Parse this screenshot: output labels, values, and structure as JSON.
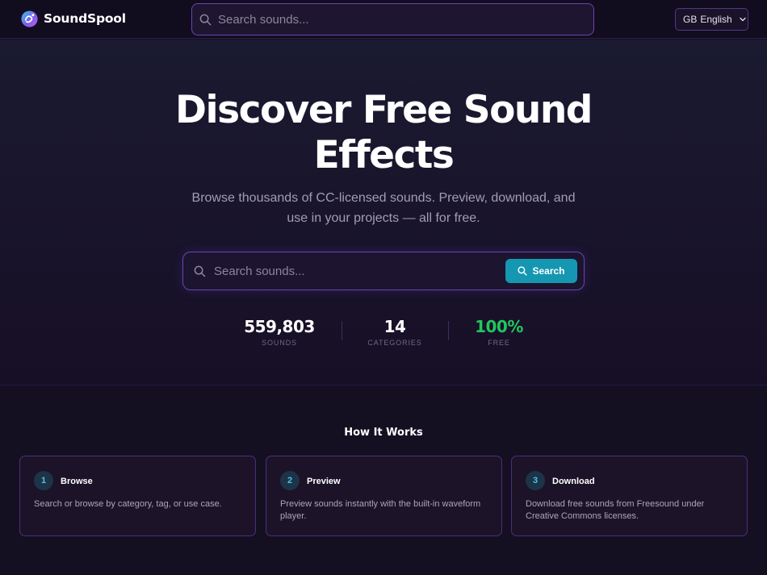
{
  "brand": {
    "name": "SoundSpool",
    "logo_icon": "logo-sound-swirl-icon"
  },
  "nav": {
    "search_placeholder": "Search sounds...",
    "language": {
      "flag": "GB",
      "label": "English"
    }
  },
  "hero": {
    "title_line1": "Discover Free Sound",
    "title_line2": "Effects",
    "subtitle_line1": "Browse thousands of CC-licensed sounds. Preview, download, and",
    "subtitle_line2": "use in your projects — all for free.",
    "search_placeholder": "Search sounds...",
    "search_button": "Search"
  },
  "stats": [
    {
      "value": "559,803",
      "label": "SOUNDS",
      "color": "#ffffff"
    },
    {
      "value": "14",
      "label": "CATEGORIES",
      "color": "#ffffff"
    },
    {
      "value": "100%",
      "label": "FREE",
      "color": "#22c55e"
    }
  ],
  "how_it_works": {
    "title": "How It Works",
    "steps": [
      {
        "number": "1",
        "title": "Browse",
        "description": "Search or browse by category, tag, or use case."
      },
      {
        "number": "2",
        "title": "Preview",
        "description": "Preview sounds instantly with the built-in waveform player."
      },
      {
        "number": "3",
        "title": "Download",
        "description": "Download free sounds from Freesound under Creative Commons licenses."
      }
    ]
  },
  "colors": {
    "accent_purple": "#6a44b3",
    "button_teal": "#1597b2",
    "free_green": "#22c55e",
    "step_number_cyan": "#4ac6e4"
  }
}
